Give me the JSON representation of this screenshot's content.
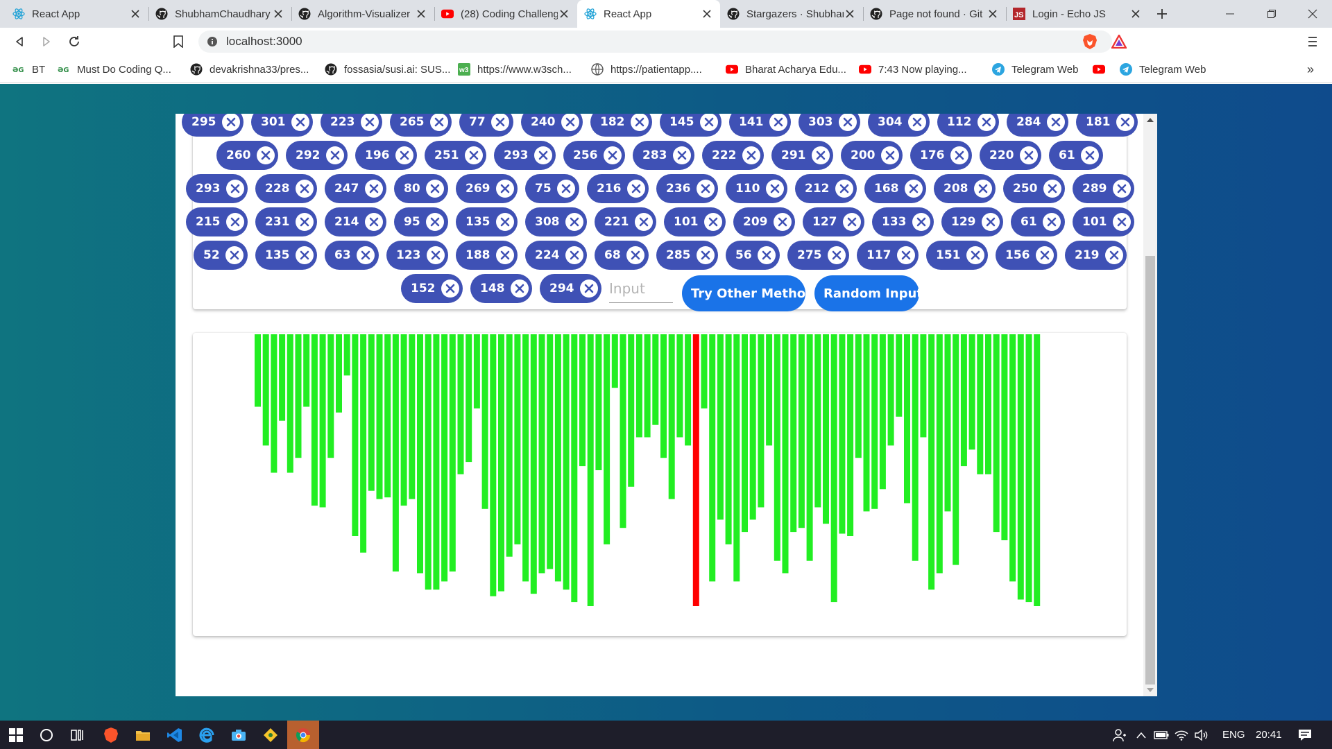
{
  "browser": {
    "tabs": [
      {
        "title": "React App",
        "icon": "react-icon",
        "active": false
      },
      {
        "title": "ShubhamChaudhary",
        "icon": "github-icon",
        "active": false
      },
      {
        "title": "Algorithm-Visualizer",
        "icon": "github-icon",
        "active": false
      },
      {
        "title": "(28) Coding Challeng",
        "icon": "youtube-icon",
        "active": false
      },
      {
        "title": "React App",
        "icon": "react-icon",
        "active": true
      },
      {
        "title": "Stargazers · Shubhar",
        "icon": "github-icon",
        "active": false
      },
      {
        "title": "Page not found · Git",
        "icon": "github-icon",
        "active": false
      },
      {
        "title": "Login - Echo JS",
        "icon": "echojs-icon",
        "active": false
      }
    ],
    "url": "localhost:3000",
    "bookmarks": [
      {
        "label": "BT",
        "icon": "gfg-icon"
      },
      {
        "label": "Must Do Coding Q...",
        "icon": "gfg-icon"
      },
      {
        "label": "devakrishna33/pres...",
        "icon": "github-icon"
      },
      {
        "label": "fossasia/susi.ai: SUS...",
        "icon": "github-icon"
      },
      {
        "label": "https://www.w3sch...",
        "icon": "w3schools-icon"
      },
      {
        "label": "https://patientapp....",
        "icon": "globe-icon"
      },
      {
        "label": "Bharat Acharya Edu...",
        "icon": "youtube-icon"
      },
      {
        "label": "7:43 Now playing...",
        "icon": "youtube-icon"
      },
      {
        "label": "Telegram Web",
        "icon": "telegram-icon"
      },
      {
        "label": "",
        "icon": "youtube-icon"
      },
      {
        "label": "Telegram Web",
        "icon": "telegram-icon"
      }
    ]
  },
  "app": {
    "chip_rows": [
      [
        "295",
        "301",
        "223",
        "265",
        "77",
        "240",
        "182",
        "145",
        "141",
        "303",
        "304",
        "112",
        "284",
        "181"
      ],
      [
        "260",
        "292",
        "196",
        "251",
        "293",
        "256",
        "283",
        "222",
        "291",
        "200",
        "176",
        "220",
        "61"
      ],
      [
        "293",
        "228",
        "247",
        "80",
        "269",
        "75",
        "216",
        "236",
        "110",
        "212",
        "168",
        "208",
        "250",
        "289"
      ],
      [
        "215",
        "231",
        "214",
        "95",
        "135",
        "308",
        "221",
        "101",
        "209",
        "127",
        "133",
        "129",
        "61",
        "101"
      ],
      [
        "52",
        "135",
        "63",
        "123",
        "188",
        "224",
        "68",
        "285",
        "56",
        "275",
        "117",
        "151",
        "156",
        "219"
      ],
      [
        "152",
        "148",
        "294"
      ]
    ],
    "input_placeholder": "Input",
    "try_other_label": "Try Other Method",
    "random_input_label": "Random Input"
  },
  "chart_data": {
    "type": "bar",
    "bar_color": "#22ee22",
    "highlight_color": "#ff0000",
    "highlight_index": 54,
    "ylim": [
      0,
      330
    ],
    "orientation": "hanging-from-top",
    "values": [
      88,
      135,
      168,
      105,
      168,
      150,
      88,
      208,
      210,
      150,
      95,
      50,
      245,
      265,
      190,
      200,
      198,
      288,
      208,
      200,
      290,
      310,
      310,
      300,
      288,
      170,
      155,
      90,
      212,
      318,
      312,
      270,
      255,
      300,
      315,
      290,
      285,
      300,
      310,
      325,
      160,
      330,
      165,
      255,
      65,
      235,
      185,
      125,
      125,
      110,
      150,
      200,
      125,
      135,
      330,
      90,
      300,
      225,
      255,
      300,
      240,
      225,
      210,
      135,
      275,
      290,
      240,
      235,
      275,
      210,
      230,
      325,
      242,
      245,
      150,
      215,
      212,
      188,
      135,
      100,
      205,
      275,
      125,
      310,
      290,
      215,
      280,
      160,
      140,
      170,
      170,
      240,
      250,
      300,
      322,
      325,
      330
    ]
  },
  "taskbar": {
    "language": "ENG",
    "time": "20:41"
  }
}
